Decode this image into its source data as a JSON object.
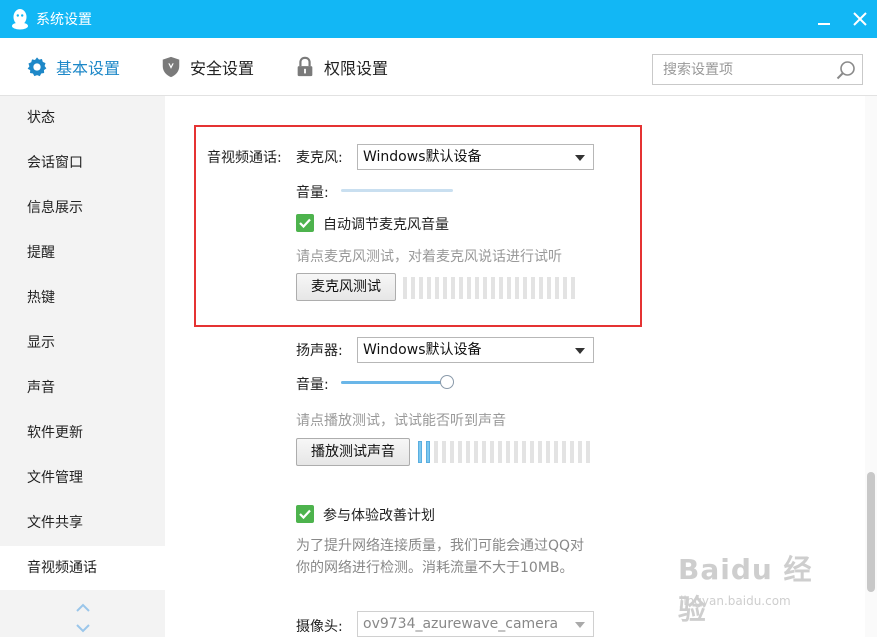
{
  "window": {
    "title": "系统设置",
    "minimize_icon": "minimize-icon",
    "close_icon": "close-icon"
  },
  "colors": {
    "titlebar": "#12b7f5",
    "accent": "#1e88c8",
    "highlight_box": "#e53333",
    "checkbox": "#4db34d"
  },
  "toolbar": {
    "tabs": [
      {
        "label": "基本设置",
        "icon": "gear-icon",
        "active": true
      },
      {
        "label": "安全设置",
        "icon": "shield-icon",
        "active": false
      },
      {
        "label": "权限设置",
        "icon": "lock-icon",
        "active": false
      }
    ],
    "search_placeholder": "搜索设置项",
    "search_value": ""
  },
  "sidebar": {
    "items": [
      {
        "label": "状态"
      },
      {
        "label": "会话窗口"
      },
      {
        "label": "信息展示"
      },
      {
        "label": "提醒"
      },
      {
        "label": "热键"
      },
      {
        "label": "显示"
      },
      {
        "label": "声音"
      },
      {
        "label": "软件更新"
      },
      {
        "label": "文件管理"
      },
      {
        "label": "文件共享"
      },
      {
        "label": "音视频通话"
      }
    ],
    "active_item": "音视频通话"
  },
  "av": {
    "section_label": "音视频通话:",
    "mic": {
      "label": "麦克风:",
      "device": "Windows默认设备",
      "volume_label": "音量:",
      "volume_level": 0.0,
      "auto_adjust_label": "自动调节麦克风音量",
      "auto_adjust_checked": true,
      "hint": "请点麦克风测试，对着麦克风说话进行试听",
      "test_button": "麦克风测试",
      "meter_level": 0
    },
    "speaker": {
      "label": "扬声器:",
      "device": "Windows默认设备",
      "volume_label": "音量:",
      "volume_level": 1.0,
      "hint": "请点播放测试，试试能否听到声音",
      "test_button": "播放测试声音",
      "meter_level": 2
    },
    "experience": {
      "label": "参与体验改善计划",
      "checked": true,
      "desc_line1": "为了提升网络连接质量，我们可能会通过QQ对",
      "desc_line2": "你的网络进行检测。消耗流量不大于10MB。"
    },
    "camera": {
      "label": "摄像头:",
      "device": "ov9734_azurewave_camera"
    }
  },
  "watermark": {
    "text": "Baidu 经验",
    "sub": "jingyan.baidu.com"
  }
}
